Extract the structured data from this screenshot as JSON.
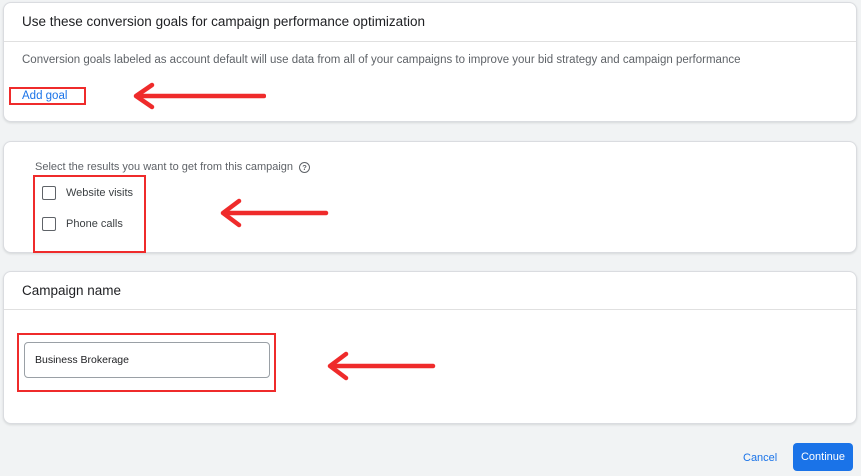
{
  "conversion_goals": {
    "title": "Use these conversion goals for campaign performance optimization",
    "description": "Conversion goals labeled as account default will use data from all of your campaigns to improve your bid strategy and campaign performance",
    "add_goal_label": "Add goal"
  },
  "results": {
    "prompt": "Select the results you want to get from this campaign",
    "help_icon": "?",
    "options": [
      {
        "label": "Website visits",
        "checked": false
      },
      {
        "label": "Phone calls",
        "checked": false
      }
    ]
  },
  "campaign_name": {
    "title": "Campaign name",
    "value": "Business Brokerage"
  },
  "footer": {
    "cancel_label": "Cancel",
    "continue_label": "Continue"
  },
  "colors": {
    "accent": "#1a73e8",
    "annotation_red": "#ef2b2b"
  }
}
